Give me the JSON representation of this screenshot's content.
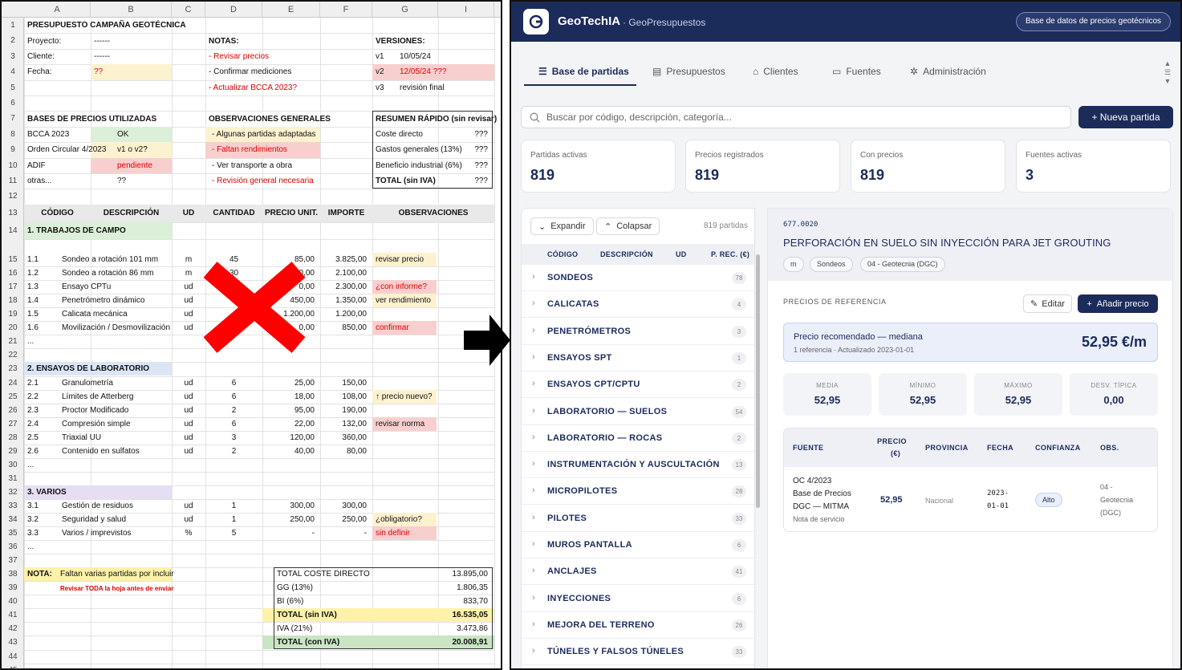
{
  "spreadsheet": {
    "columns": [
      "A",
      "B",
      "C",
      "D",
      "E",
      "F",
      "G",
      "I"
    ],
    "rows": [
      "1",
      "2",
      "3",
      "4",
      "5",
      "6",
      "7",
      "8",
      "9",
      "10",
      "11",
      "12",
      "13",
      "14",
      "15",
      "16",
      "17",
      "18",
      "19",
      "20",
      "21",
      "22",
      "23",
      "24",
      "25",
      "26",
      "27",
      "28",
      "29",
      "30",
      "31",
      "32",
      "33",
      "34",
      "35",
      "36",
      "37",
      "38",
      "39",
      "40",
      "41",
      "42",
      "43",
      "44",
      "45"
    ],
    "title": "PRESUPUESTO CAMPAÑA GEOTÉCNICA",
    "proyecto_label": "Proyecto:",
    "proyecto_val": "------",
    "cliente_label": "Cliente:",
    "cliente_val": "------",
    "fecha_label": "Fecha:",
    "fecha_val": "??",
    "notas_label": "NOTAS:",
    "notas": [
      "- Revisar precios",
      "- Confirmar mediciones",
      "- Actualizar BCCA 2023?"
    ],
    "versiones_label": "VERSIONES:",
    "versiones": [
      {
        "v": "v1",
        "d": "10/05/24"
      },
      {
        "v": "v2",
        "d": "12/05/24 ???"
      },
      {
        "v": "v3",
        "d": "revisión final"
      }
    ],
    "bases_label": "BASES DE PRECIOS UTILIZADAS",
    "bases": [
      {
        "n": "BCCA 2023",
        "s": "OK"
      },
      {
        "n": "Orden Circular 4/2023",
        "s": "v1 o v2?"
      },
      {
        "n": "ADIF",
        "s": "pendiente"
      },
      {
        "n": "otras...",
        "s": "??"
      }
    ],
    "obs_label": "OBSERVACIONES GENERALES",
    "obs": [
      "- Algunas partidas adaptadas",
      "- Faltan rendimientos",
      "- Ver transporte a obra",
      "- Revisión general necesaria"
    ],
    "resumen_label": "RESUMEN RÁPIDO (sin revisar)",
    "resumen": [
      {
        "n": "Coste directo",
        "v": "???"
      },
      {
        "n": "Gastos generales (13%)",
        "v": "???"
      },
      {
        "n": "Beneficio industrial (6%)",
        "v": "???"
      },
      {
        "n": "TOTAL (sin IVA)",
        "v": "???"
      }
    ],
    "headers": [
      "CÓDIGO",
      "DESCRIPCIÓN",
      "UD",
      "CANTIDAD",
      "PRECIO UNIT.",
      "IMPORTE",
      "OBSERVACIONES"
    ],
    "section1": "1. TRABAJOS DE CAMPO",
    "items1": [
      {
        "c": "1.1",
        "d": "Sondeo a rotación 101 mm",
        "u": "m",
        "q": "45",
        "p": "85,00",
        "i": "3.825,00",
        "o": "revisar precio"
      },
      {
        "c": "1.2",
        "d": "Sondeo a rotación 86 mm",
        "u": "m",
        "q": "30",
        "p": "70,00",
        "i": "2.100,00",
        "o": ""
      },
      {
        "c": "1.3",
        "d": "Ensayo CPTu",
        "u": "ud",
        "q": "",
        "p": "0,00",
        "i": "2.300,00",
        "o": "¿con informe?"
      },
      {
        "c": "1.4",
        "d": "Penetrómetro dinámico",
        "u": "ud",
        "q": "",
        "p": "450,00",
        "i": "1.350,00",
        "o": "ver rendimiento"
      },
      {
        "c": "1.5",
        "d": "Calicata mecánica",
        "u": "ud",
        "q": "",
        "p": "1.200,00",
        "i": "1.200,00",
        "o": ""
      },
      {
        "c": "1.6",
        "d": "Movilización / Desmovilización",
        "u": "ud",
        "q": "",
        "p": "0,00",
        "i": "850,00",
        "o": "confirmar"
      },
      {
        "c": "...",
        "d": "",
        "u": "",
        "q": "",
        "p": "",
        "i": "",
        "o": ""
      }
    ],
    "section2": "2. ENSAYOS DE LABORATORIO",
    "items2": [
      {
        "c": "2.1",
        "d": "Granulometría",
        "u": "ud",
        "q": "6",
        "p": "25,00",
        "i": "150,00",
        "o": ""
      },
      {
        "c": "2.2",
        "d": "Límites de Atterberg",
        "u": "ud",
        "q": "6",
        "p": "18,00",
        "i": "108,00",
        "o": "↑ precio nuevo?"
      },
      {
        "c": "2.3",
        "d": "Proctor Modificado",
        "u": "ud",
        "q": "2",
        "p": "95,00",
        "i": "190,00",
        "o": ""
      },
      {
        "c": "2.4",
        "d": "Compresión simple",
        "u": "ud",
        "q": "6",
        "p": "22,00",
        "i": "132,00",
        "o": "revisar norma"
      },
      {
        "c": "2.5",
        "d": "Triaxial UU",
        "u": "ud",
        "q": "3",
        "p": "120,00",
        "i": "360,00",
        "o": ""
      },
      {
        "c": "2.6",
        "d": "Contenido en sulfatos",
        "u": "ud",
        "q": "2",
        "p": "40,00",
        "i": "80,00",
        "o": ""
      },
      {
        "c": "...",
        "d": "",
        "u": "",
        "q": "",
        "p": "",
        "i": "",
        "o": ""
      }
    ],
    "section3": "3. VARIOS",
    "items3": [
      {
        "c": "3.1",
        "d": "Gestión de residuos",
        "u": "ud",
        "q": "1",
        "p": "300,00",
        "i": "300,00",
        "o": ""
      },
      {
        "c": "3.2",
        "d": "Seguridad y salud",
        "u": "ud",
        "q": "1",
        "p": "250,00",
        "i": "250,00",
        "o": "¿obligatorio?"
      },
      {
        "c": "3.3",
        "d": "Varios / imprevistos",
        "u": "%",
        "q": "5",
        "p": "-",
        "i": "-",
        "o": "sin definir"
      },
      {
        "c": "...",
        "d": "",
        "u": "",
        "q": "",
        "p": "",
        "i": "",
        "o": ""
      }
    ],
    "nota_label": "NOTA:",
    "nota_text": "Faltan varias partidas por incluir",
    "nota_red": "Revisar TODA la hoja antes de enviar",
    "totals": [
      {
        "n": "TOTAL COSTE DIRECTO",
        "v": "13.895,00"
      },
      {
        "n": "GG (13%)",
        "v": "1.806,35"
      },
      {
        "n": "BI (6%)",
        "v": "833,70"
      },
      {
        "n": "TOTAL (sin IVA)",
        "v": "16.535,05"
      },
      {
        "n": "IVA (21%)",
        "v": "3.473,86"
      },
      {
        "n": "TOTAL (con IVA)",
        "v": "20.008,91"
      }
    ]
  },
  "app": {
    "brand": "GeoTechIA",
    "brand_sub": "· GeoPresupuestos",
    "db_button": "Base de datos de precios geotécnicos",
    "tabs": [
      "Base de partidas",
      "Presupuestos",
      "Clientes",
      "Fuentes",
      "Administración"
    ],
    "search_placeholder": "Buscar por código, descripción, categoría...",
    "new_button": "+ Nueva partida",
    "stats": [
      {
        "label": "Partidas activas",
        "value": "819"
      },
      {
        "label": "Precios registrados",
        "value": "819"
      },
      {
        "label": "Con precios",
        "value": "819"
      },
      {
        "label": "Fuentes activas",
        "value": "3"
      }
    ],
    "expand": "Expandir",
    "collapse": "Colapsar",
    "count": "819 partidas",
    "list_headers": [
      "CÓDIGO",
      "DESCRIPCIÓN",
      "UD",
      "P. REC. (€)"
    ],
    "categories": [
      {
        "name": "SONDEOS",
        "count": "78"
      },
      {
        "name": "CALICATAS",
        "count": "4"
      },
      {
        "name": "PENETRÓMETROS",
        "count": "3"
      },
      {
        "name": "ENSAYOS SPT",
        "count": "1"
      },
      {
        "name": "ENSAYOS CPT/CPTU",
        "count": "2"
      },
      {
        "name": "LABORATORIO — SUELOS",
        "count": "54"
      },
      {
        "name": "LABORATORIO — ROCAS",
        "count": "2"
      },
      {
        "name": "INSTRUMENTACIÓN Y AUSCULTACIÓN",
        "count": "13"
      },
      {
        "name": "MICROPILOTES",
        "count": "28"
      },
      {
        "name": "PILOTES",
        "count": "33"
      },
      {
        "name": "MUROS PANTALLA",
        "count": "6"
      },
      {
        "name": "ANCLAJES",
        "count": "41"
      },
      {
        "name": "INYECCIONES",
        "count": "6"
      },
      {
        "name": "MEJORA DEL TERRENO",
        "count": "26"
      },
      {
        "name": "TÚNELES Y FALSOS TÚNELES",
        "count": "33"
      }
    ],
    "detail": {
      "code": "677.0020",
      "title": "PERFORACIÓN EN SUELO SIN INYECCIÓN PARA JET GROUTING",
      "chips": [
        "m",
        "Sondeos",
        "04 - Geotecnia (DGC)"
      ],
      "section": "PRECIOS DE REFERENCIA",
      "edit": "Editar",
      "add": "Añadir precio",
      "rec_title": "Precio recomendado — mediana",
      "rec_sub": "1 referencia · Actualizado 2023-01-01",
      "rec_value": "52,95 €/m",
      "stats": [
        {
          "label": "MEDIA",
          "value": "52,95"
        },
        {
          "label": "MÍNIMO",
          "value": "52,95"
        },
        {
          "label": "MÁXIMO",
          "value": "52,95"
        },
        {
          "label": "DESV. TÍPICA",
          "value": "0,00"
        }
      ],
      "table_headers": [
        "FUENTE",
        "PRECIO",
        "(€)",
        "PROVINCIA",
        "FECHA",
        "CONFIANZA",
        "OBS."
      ],
      "row": {
        "fuente1": "OC 4/2023",
        "fuente2": "Base de Precios",
        "fuente3": "DGC — MITMA",
        "fuente4": "Nota de servicio",
        "precio": "52,95",
        "provincia": "Nacional",
        "fecha1": "2023-",
        "fecha2": "01-01",
        "confianza": "Alto",
        "obs1": "04 -",
        "obs2": "Geotecnia",
        "obs3": "(DGC)"
      }
    }
  }
}
